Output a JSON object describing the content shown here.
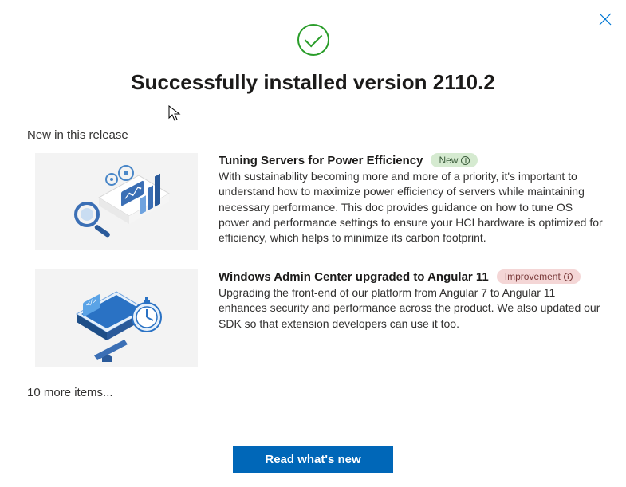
{
  "title": "Successfully installed version 2110.2",
  "section_heading": "New in this release",
  "items": [
    {
      "title": "Tuning Servers for Power Efficiency",
      "badge_label": "New",
      "badge_type": "new",
      "body": "With sustainability becoming more and more of a priority, it's important to understand how to maximize power efficiency of servers while maintaining necessary performance. This doc provides guidance on how to tune OS power and performance settings to ensure your HCI hardware is optimized for efficiency, which helps to minimize its carbon footprint."
    },
    {
      "title": "Windows Admin Center upgraded to Angular 11",
      "badge_label": "Improvement",
      "badge_type": "improvement",
      "body": "Upgrading the front-end of our platform from Angular 7 to Angular 11 enhances security and performance across the product. We also updated our SDK so that extension developers can use it too."
    }
  ],
  "more_items": "10 more items...",
  "primary_button": "Read what's new"
}
